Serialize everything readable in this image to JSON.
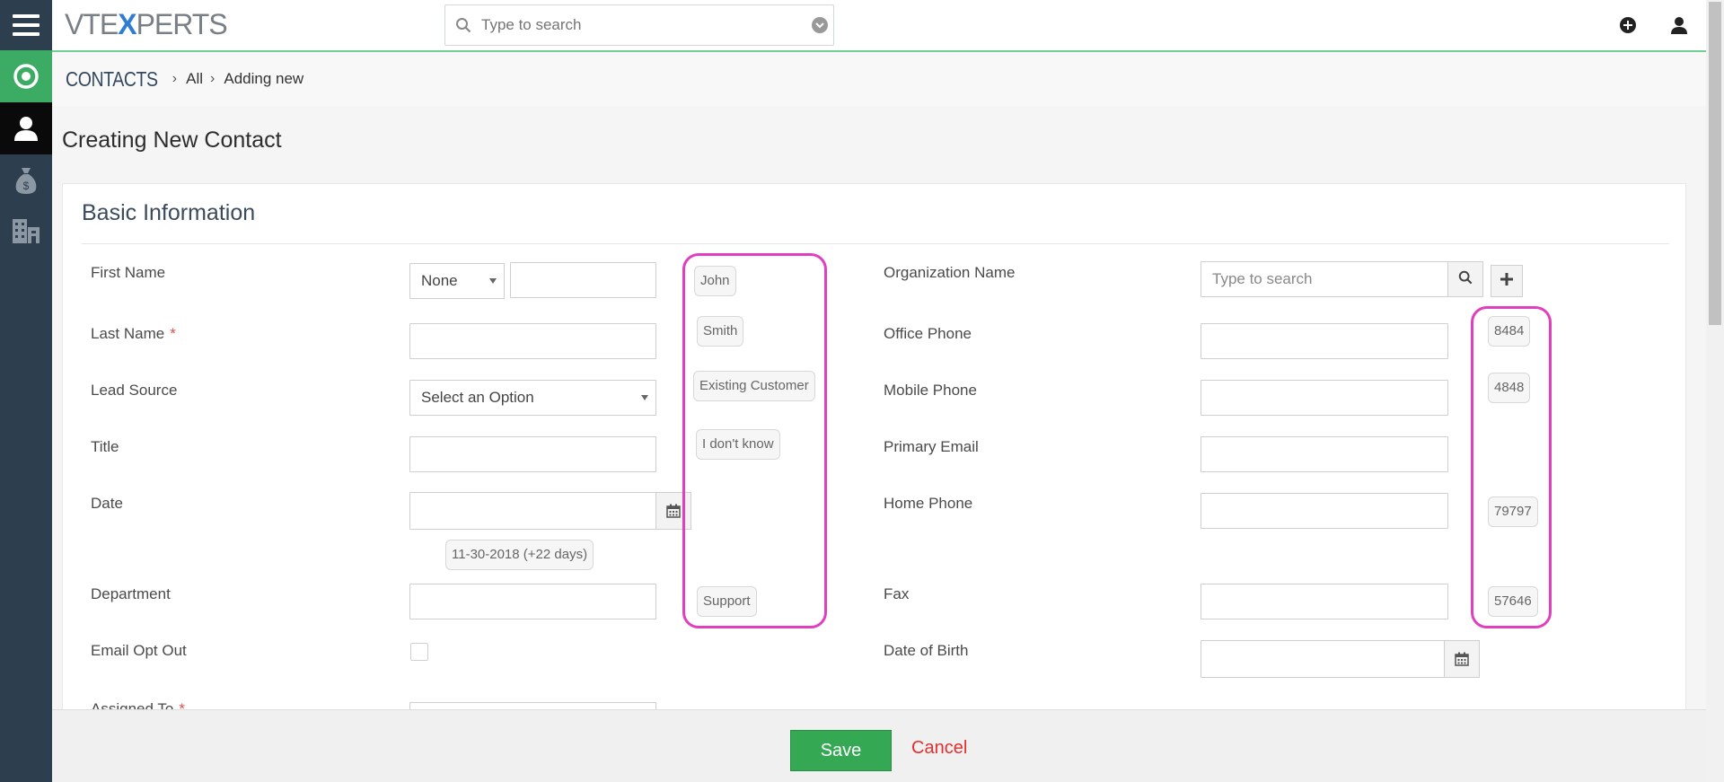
{
  "logo": {
    "part1": "VTE",
    "x": "X",
    "part2": "PERTS"
  },
  "search": {
    "placeholder": "Type to search"
  },
  "breadcrumb": {
    "module": "CONTACTS",
    "level1": "All",
    "level2": "Adding new"
  },
  "page_title": "Creating New Contact",
  "section_title": "Basic Information",
  "fields": {
    "first_name": {
      "label": "First Name",
      "salutation": "None"
    },
    "last_name": {
      "label": "Last Name",
      "required": "*"
    },
    "lead_source": {
      "label": "Lead Source",
      "placeholder": "Select an Option"
    },
    "title": {
      "label": "Title"
    },
    "date": {
      "label": "Date",
      "hint": "11-30-2018 (+22 days)"
    },
    "department": {
      "label": "Department"
    },
    "email_opt_out": {
      "label": "Email Opt Out"
    },
    "assigned_to": {
      "label": "Assigned To",
      "required": "*"
    },
    "organization_name": {
      "label": "Organization Name",
      "placeholder": "Type to search"
    },
    "office_phone": {
      "label": "Office Phone"
    },
    "mobile_phone": {
      "label": "Mobile Phone"
    },
    "primary_email": {
      "label": "Primary Email"
    },
    "home_phone": {
      "label": "Home Phone"
    },
    "fax": {
      "label": "Fax"
    },
    "date_of_birth": {
      "label": "Date of Birth"
    }
  },
  "suggestions_left": [
    "John",
    "Smith",
    "Existing Customer",
    "I don't know",
    "Support"
  ],
  "suggestions_right": [
    "8484",
    "4848",
    "79797",
    "57646"
  ],
  "footer": {
    "save": "Save",
    "cancel": "Cancel"
  },
  "colors": {
    "sidebar": "#2d3e4f",
    "active_green": "#3cab64",
    "save_green": "#35a854",
    "cancel_red": "#e3302f",
    "highlight": "#e040c0",
    "required": "#e34c4c"
  }
}
